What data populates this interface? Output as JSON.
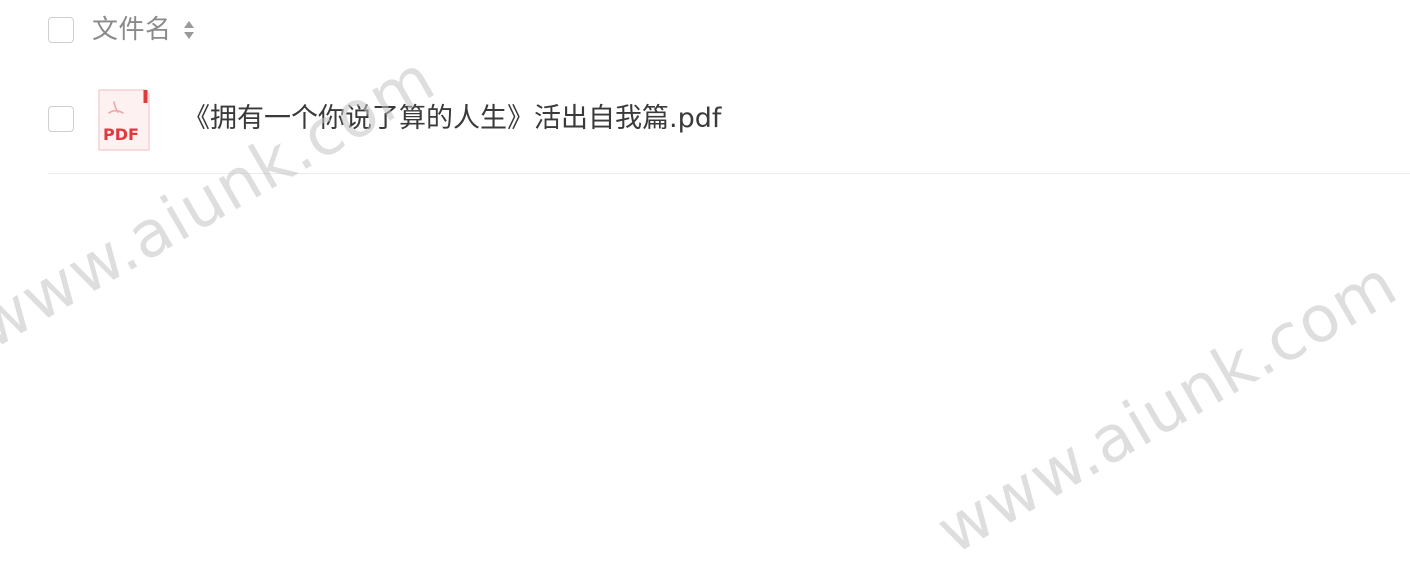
{
  "file_list": {
    "header": {
      "column_label": "文件名"
    },
    "rows": [
      {
        "file_type_label": "PDF",
        "name": "《拥有一个你说了算的人生》活出自我篇.pdf"
      }
    ]
  },
  "watermarks": [
    "www.aiunk.com",
    "www.aiunk.com"
  ],
  "colors": {
    "pdf_red": "#e0393e",
    "text": "#3a3a3a",
    "header_text": "#8a8a8a",
    "divider": "#ececec"
  },
  "icons": [
    "sort-icon",
    "pdf-file-icon"
  ]
}
